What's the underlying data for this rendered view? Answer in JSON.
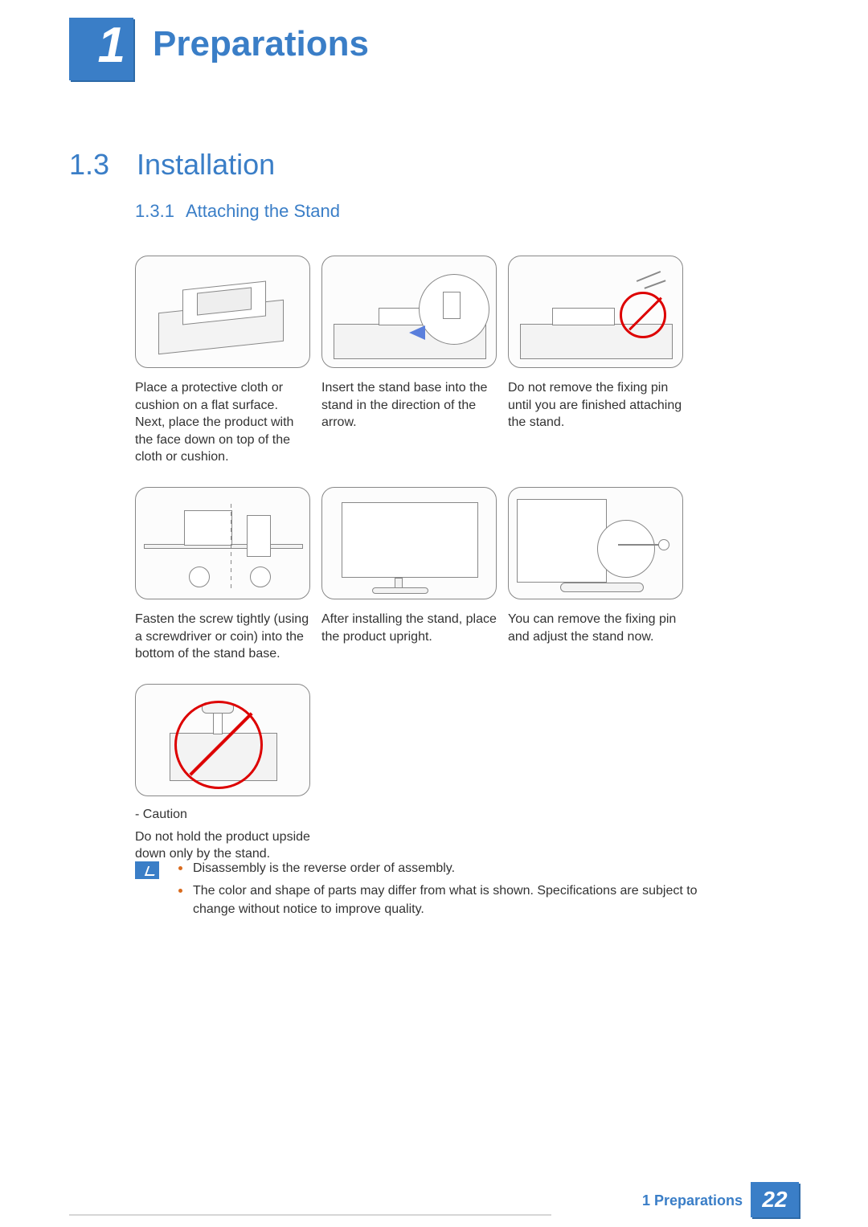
{
  "chapter": {
    "number": "1",
    "title": "Preparations"
  },
  "section": {
    "number": "1.3",
    "title": "Installation"
  },
  "subsection": {
    "number": "1.3.1",
    "title": "Attaching the Stand"
  },
  "steps": [
    {
      "caption": "Place a protective cloth or cushion on a flat surface. Next, place the product with the face down on top of the cloth or cushion."
    },
    {
      "caption": "Insert the stand base into the stand in the direction of the arrow."
    },
    {
      "caption": "Do not remove the fixing pin until you are finished attaching the stand."
    },
    {
      "caption": "Fasten the screw tightly (using a screwdriver or coin) into the bottom of the stand base."
    },
    {
      "caption": "After installing the stand, place the product upright."
    },
    {
      "caption": "You can remove the fixing pin and adjust the stand now."
    }
  ],
  "caution": {
    "label": "- Caution",
    "text": "Do not hold the product upside down only by the stand."
  },
  "notes": [
    "Disassembly is the reverse order of assembly.",
    "The color and shape of parts may differ from what is shown. Specifications are subject to change without notice to improve quality."
  ],
  "footer": {
    "text": "1 Preparations",
    "page": "22"
  }
}
